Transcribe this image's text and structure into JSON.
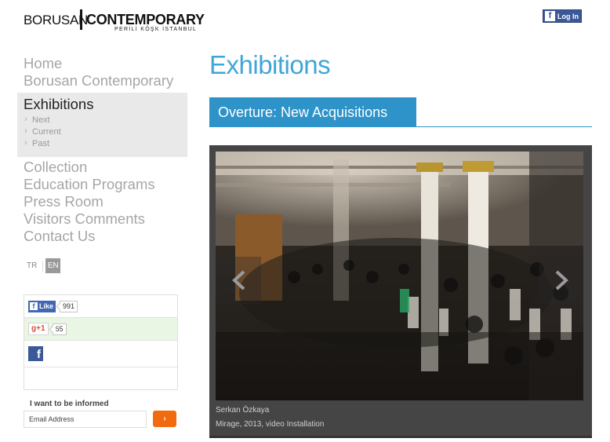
{
  "logo": {
    "brand": "BORUSAN",
    "name": "CONTEMPORARY",
    "sub": "PERİLİ KÖŞK İSTANBUL"
  },
  "header": {
    "fb_login": "Log In"
  },
  "nav": {
    "items_top": [
      "Home",
      "Borusan Contemporary"
    ],
    "active": "Exhibitions",
    "subitems": [
      "Next",
      "Current",
      "Past"
    ],
    "items_bottom": [
      "Collection",
      "Education Programs",
      "Press Room",
      "Visitors Comments",
      "Contact Us"
    ]
  },
  "lang": {
    "tr": "TR",
    "en": "EN"
  },
  "social": {
    "like": "Like",
    "like_count": "991",
    "gplus": "+1",
    "gplus_count": "65"
  },
  "newsletter": {
    "label": "I want to be informed",
    "placeholder": "Email Address",
    "button": "›"
  },
  "main": {
    "title": "Exhibitions",
    "exhibition": "Overture: New Acquisitions",
    "artist": "Serkan Özkaya",
    "work": "Mirage, 2013, video Installation"
  },
  "colors": {
    "accent": "#3fa6d8",
    "bar": "#2e93c9",
    "orange": "#f26a0f",
    "facebook": "#3b5998"
  }
}
